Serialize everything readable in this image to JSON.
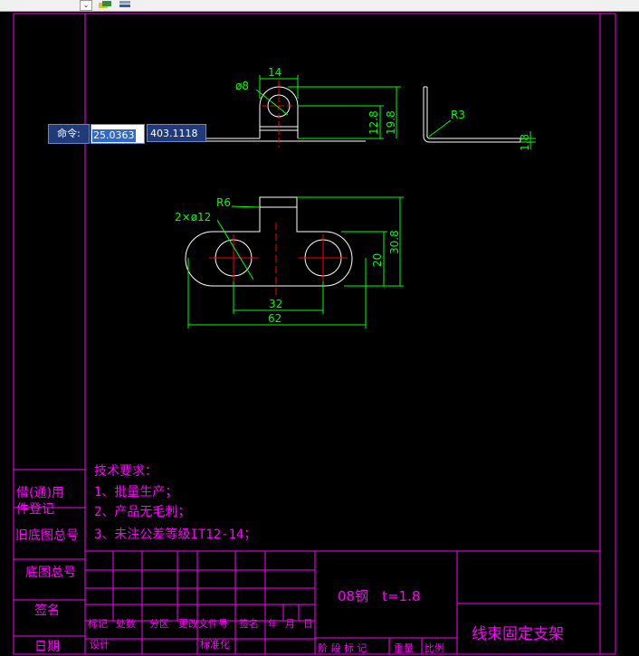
{
  "toolbar": {
    "dropdown_arrow": "⌄",
    "icons": [
      "layer-state-icon",
      "layer-previous-icon"
    ]
  },
  "dimensions": {
    "top_dia": "ø8",
    "top_width": "14",
    "top_h1": "12.8",
    "top_h2": "19.8",
    "side_radius": "R3",
    "side_thick": "1.8",
    "holes": "2×ø12",
    "corner_radius": "R6",
    "hole_spacing": "32",
    "overall_width": "62",
    "hole_height": "20",
    "overall_height": "30.8"
  },
  "notes": {
    "heading": "技术要求：",
    "items": [
      "1、批量生产；",
      "2、产品无毛刺；",
      "3、未注公差等级IT12-14；"
    ]
  },
  "left_strip": {
    "labels": [
      "借(通)用",
      "件登记",
      "旧底图总号",
      "底图总号",
      "签名",
      "日期"
    ]
  },
  "title_block": {
    "material": "08钢　t=1.8",
    "part_name": "线束固定支架",
    "header_row": [
      "标记",
      "处数",
      "分区",
      "更改文件号",
      "签名",
      "年",
      "月",
      "日"
    ],
    "design": "设计",
    "standardize": "标准化",
    "stage_mark": "阶 段 标 记",
    "weight": "重量",
    "scale": "比例"
  },
  "command": {
    "label": "命令:",
    "x_value": "25.0363",
    "y_value": "403.1118"
  },
  "colors": {
    "frame": "#ff00ff",
    "dim": "#00ff00",
    "geometry": "#ffffff",
    "center": "#ff0000"
  }
}
